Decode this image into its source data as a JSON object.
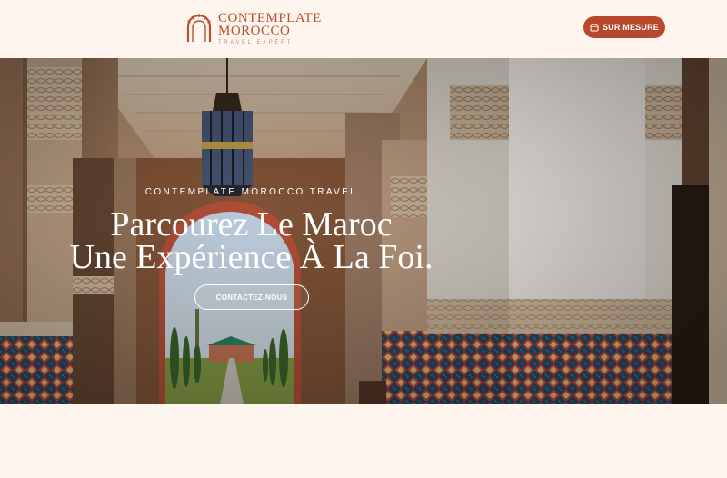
{
  "header": {
    "logo": {
      "line1": "CONTEMPLATE",
      "line2": "MOROCCO",
      "tagline": "TRAVEL EXPERT"
    },
    "cta": {
      "label": "SUR MESURE",
      "icon": "calendar-icon"
    }
  },
  "hero": {
    "eyebrow": "CONTEMPLATE MOROCCO TRAVEL",
    "headline_line1": "Parcourez Le Maroc",
    "headline_line2": "Une Expérience À La Foi.",
    "button_label": "CONTACTEZ-NOUS"
  },
  "colors": {
    "brand": "#b8482b",
    "background": "#fdf5ee",
    "text_on_image": "#ffffff"
  }
}
